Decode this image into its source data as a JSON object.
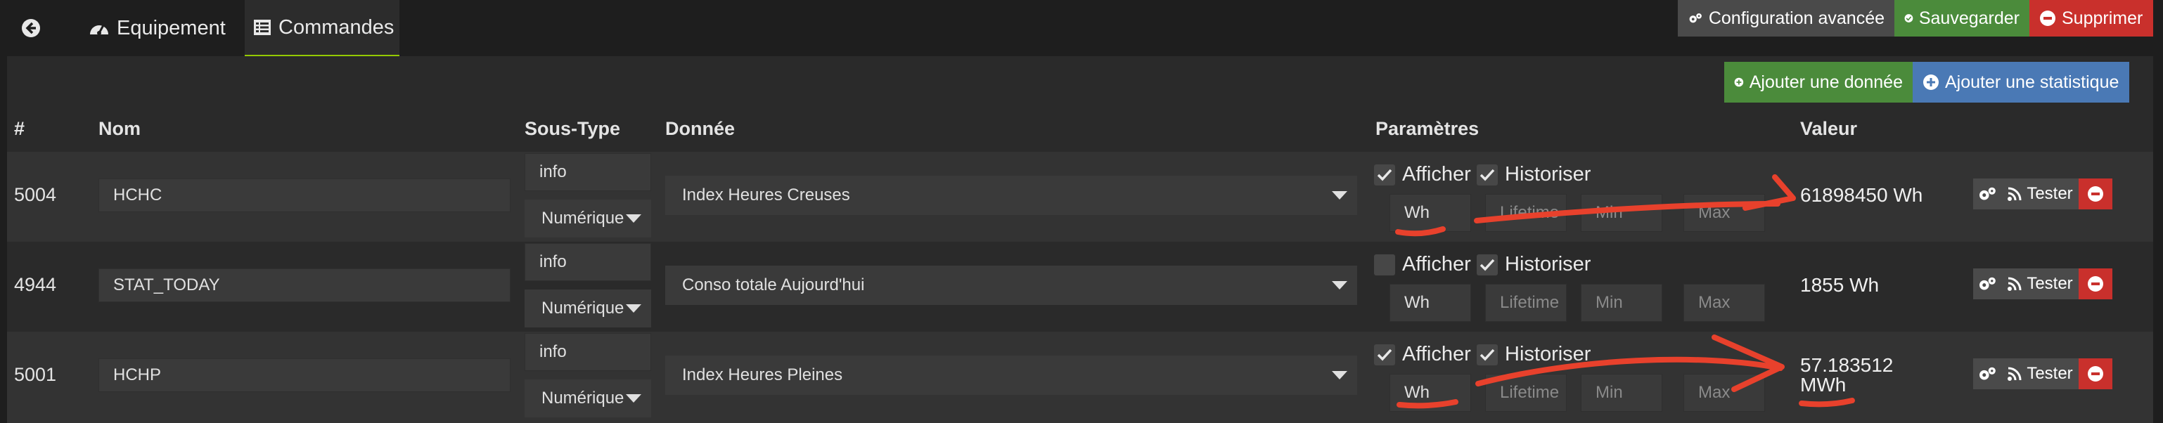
{
  "tabs": {
    "back_icon": "arrow-circle-left-icon",
    "equipement": {
      "label": "Equipement",
      "icon": "tachometer-icon"
    },
    "commandes": {
      "label": "Commandes",
      "icon": "list-alt-icon"
    }
  },
  "toolbar": {
    "config": {
      "label": "Configuration avancée",
      "icon": "cogs-icon",
      "color": "#4a4a4a"
    },
    "save": {
      "label": "Sauvegarder",
      "icon": "check-circle-icon",
      "color": "#4b8b3b"
    },
    "delete": {
      "label": "Supprimer",
      "icon": "minus-circle-icon",
      "color": "#c9302c"
    }
  },
  "add_buttons": {
    "data": {
      "label": "Ajouter une donnée",
      "icon": "plus-circle-icon",
      "color": "#4b8b3b"
    },
    "stat": {
      "label": "Ajouter une statistique",
      "icon": "plus-circle-icon",
      "color": "#4a79b5"
    }
  },
  "columns": {
    "id": "#",
    "name": "Nom",
    "subtype": "Sous-Type",
    "data": "Donnée",
    "params": "Paramètres",
    "value": "Valeur"
  },
  "param_labels": {
    "afficher": "Afficher",
    "historiser": "Historiser"
  },
  "placeholders": {
    "lifetime": "Lifetime",
    "min": "Min",
    "max": "Max"
  },
  "commands": [
    {
      "id": "5004",
      "name": "HCHC",
      "type": "info",
      "subtype": "Numérique",
      "donnee": "Index Heures Creuses",
      "afficher": true,
      "historiser": true,
      "unit": "Wh",
      "value": "61898450 Wh"
    },
    {
      "id": "4944",
      "name": "STAT_TODAY",
      "type": "info",
      "subtype": "Numérique",
      "donnee": "Conso totale Aujourd'hui",
      "afficher": false,
      "historiser": true,
      "unit": "Wh",
      "value": "1855 Wh"
    },
    {
      "id": "5001",
      "name": "HCHP",
      "type": "info",
      "subtype": "Numérique",
      "donnee": "Index Heures Pleines",
      "afficher": true,
      "historiser": true,
      "unit": "Wh",
      "value_line1": "57.183512",
      "value_line2": "MWh"
    }
  ],
  "row_actions": {
    "config_icon": "cogs-icon",
    "tester": "Tester",
    "tester_icon": "rss-icon",
    "delete_icon": "minus-circle-icon"
  },
  "colors": {
    "background": "#1e1e1e",
    "panel": "#2a2a2a",
    "row_alt": "#333333",
    "input": "#3a3a3a",
    "annotation": "#e8412c",
    "accent": "#94ca02"
  }
}
